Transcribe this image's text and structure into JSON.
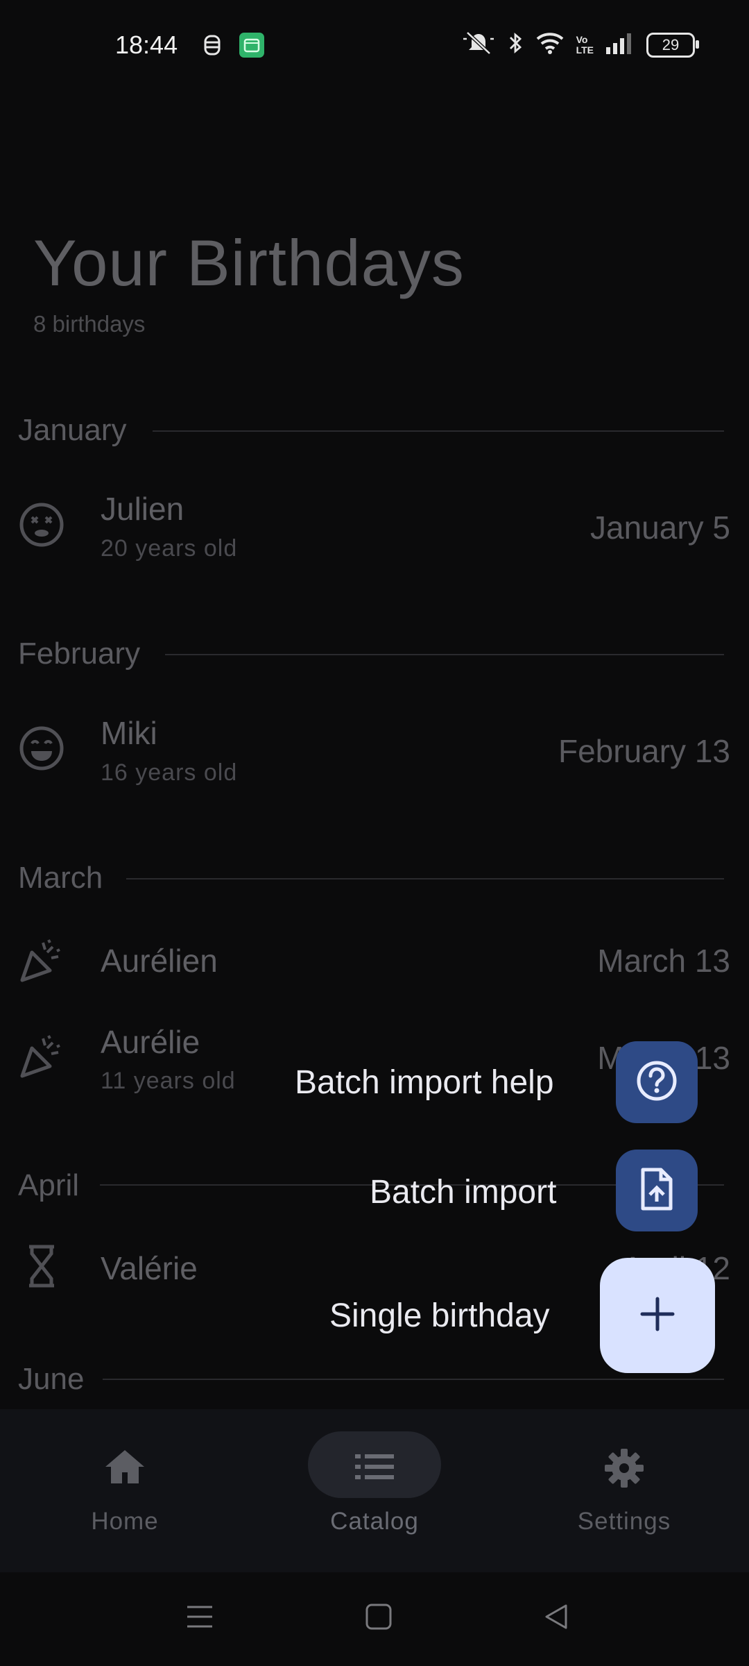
{
  "status": {
    "time": "18:44",
    "battery": "29"
  },
  "header": {
    "title": "Your Birthdays",
    "subtitle": "8 birthdays"
  },
  "months": [
    {
      "name": "January"
    },
    {
      "name": "February"
    },
    {
      "name": "March"
    },
    {
      "name": "April"
    },
    {
      "name": "June"
    }
  ],
  "people": [
    {
      "name": "Julien",
      "age": "20 years old",
      "date": "January 5",
      "icon": "dizzy-face-icon"
    },
    {
      "name": "Miki",
      "age": "16 years old",
      "date": "February 13",
      "icon": "smiling-face-icon"
    },
    {
      "name": "Aurélien",
      "age": "",
      "date": "March 13",
      "icon": "party-popper-icon"
    },
    {
      "name": "Aurélie",
      "age": "11 years old",
      "date": "March 13",
      "icon": "party-popper-icon"
    },
    {
      "name": "Valérie",
      "age": "",
      "date": "April 12",
      "icon": "hourglass-icon"
    }
  ],
  "fab_menu": {
    "help_label": "Batch import help",
    "batch_label": "Batch import",
    "single_label": "Single birthday"
  },
  "bottom_nav": {
    "home": "Home",
    "catalog": "Catalog",
    "settings": "Settings",
    "selected": "Catalog"
  },
  "colors": {
    "accent_fab": "#d9e2ff",
    "mini_fab": "#2e4a86",
    "background": "#0b0b0c"
  }
}
